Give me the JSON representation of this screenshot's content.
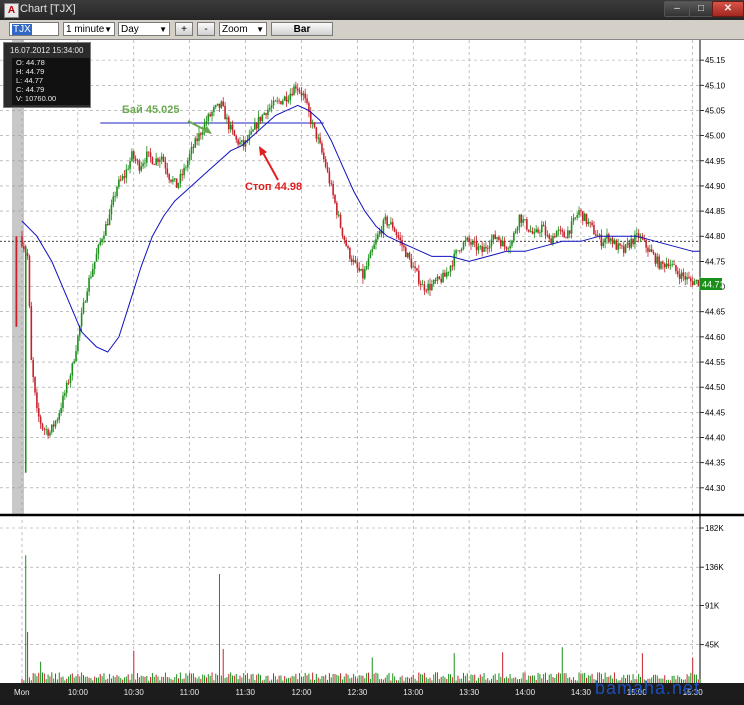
{
  "window": {
    "title": "Chart [TJX]",
    "icon": "app-logo-icon",
    "buttons": {
      "minimize": "–",
      "maximize": "□",
      "close": "✕"
    }
  },
  "toolbar": {
    "symbol": "TJX",
    "interval": "1 minute",
    "range": "Day",
    "zoom_in": "+",
    "zoom_out": "-",
    "zoom": "Zoom",
    "chart_type": "Bar"
  },
  "ohlc_panel": {
    "datetime": "16.07.2012 15:34:00",
    "open": "O: 44.78",
    "high": "H: 44.79",
    "low": "L: 44.77",
    "close": "C: 44.79",
    "volume": "V: 10760.00"
  },
  "annotations": {
    "buy": "Бай 45.025",
    "stop": "Стоп 44.98"
  },
  "colors": {
    "up": "#1a8f1a",
    "down": "#c8202a",
    "ma": "#1010c0",
    "buy_label": "#6aa84f",
    "stop_label": "#e02020",
    "last_price_tag": "#1a8f1a"
  },
  "watermark": "bamaha.net",
  "chart_data": [
    {
      "type": "candlestick",
      "title": "",
      "x_tick_labels": [
        "Mon",
        "10:00",
        "10:30",
        "11:00",
        "11:30",
        "12:00",
        "12:30",
        "13:00",
        "13:30",
        "14:00",
        "14:30",
        "15:00",
        "15:30"
      ],
      "x_tick_minutes": [
        0,
        30,
        60,
        90,
        120,
        150,
        180,
        210,
        240,
        270,
        300,
        330,
        360
      ],
      "price_ticks": [
        45.15,
        45.1,
        45.05,
        45.0,
        44.95,
        44.9,
        44.85,
        44.8,
        44.75,
        44.7,
        44.65,
        44.6,
        44.55,
        44.5,
        44.45,
        44.4,
        44.35,
        44.3
      ],
      "price_tick_labels": [
        "45.15",
        "45.10",
        "45.05",
        "45.00",
        "44.95",
        "44.90",
        "44.85",
        "44.80",
        "44.75",
        "44.70",
        "44.65",
        "44.60",
        "44.55",
        "44.50",
        "44.45",
        "44.40",
        "44.35",
        "44.30"
      ],
      "ylim": [
        44.25,
        45.19
      ],
      "last_price": "44.71",
      "reference_level": 44.79,
      "buy_level": 45.025,
      "stop_level": 44.98,
      "price_path": [
        [
          0,
          44.8
        ],
        [
          4,
          44.76
        ],
        [
          6,
          44.55
        ],
        [
          9,
          44.45
        ],
        [
          12,
          44.42
        ],
        [
          16,
          44.41
        ],
        [
          20,
          44.44
        ],
        [
          25,
          44.5
        ],
        [
          28,
          44.54
        ],
        [
          32,
          44.62
        ],
        [
          36,
          44.7
        ],
        [
          40,
          44.75
        ],
        [
          44,
          44.8
        ],
        [
          48,
          44.84
        ],
        [
          52,
          44.9
        ],
        [
          56,
          44.92
        ],
        [
          60,
          44.96
        ],
        [
          64,
          44.94
        ],
        [
          68,
          44.96
        ],
        [
          72,
          44.95
        ],
        [
          76,
          44.96
        ],
        [
          80,
          44.92
        ],
        [
          84,
          44.9
        ],
        [
          88,
          44.93
        ],
        [
          92,
          44.97
        ],
        [
          96,
          45.0
        ],
        [
          100,
          45.03
        ],
        [
          104,
          45.05
        ],
        [
          108,
          45.06
        ],
        [
          112,
          45.02
        ],
        [
          116,
          44.99
        ],
        [
          120,
          44.98
        ],
        [
          124,
          45.0
        ],
        [
          128,
          45.03
        ],
        [
          132,
          45.05
        ],
        [
          136,
          45.06
        ],
        [
          140,
          45.07
        ],
        [
          144,
          45.08
        ],
        [
          148,
          45.1
        ],
        [
          152,
          45.08
        ],
        [
          156,
          45.03
        ],
        [
          160,
          44.99
        ],
        [
          164,
          44.94
        ],
        [
          168,
          44.88
        ],
        [
          172,
          44.82
        ],
        [
          176,
          44.77
        ],
        [
          180,
          44.74
        ],
        [
          184,
          44.72
        ],
        [
          188,
          44.76
        ],
        [
          192,
          44.8
        ],
        [
          196,
          44.83
        ],
        [
          200,
          44.82
        ],
        [
          204,
          44.79
        ],
        [
          208,
          44.76
        ],
        [
          212,
          44.73
        ],
        [
          216,
          44.7
        ],
        [
          220,
          44.7
        ],
        [
          224,
          44.71
        ],
        [
          228,
          44.72
        ],
        [
          232,
          44.75
        ],
        [
          236,
          44.78
        ],
        [
          240,
          44.79
        ],
        [
          244,
          44.78
        ],
        [
          248,
          44.77
        ],
        [
          252,
          44.79
        ],
        [
          256,
          44.8
        ],
        [
          260,
          44.78
        ],
        [
          264,
          44.79
        ],
        [
          268,
          44.84
        ],
        [
          272,
          44.82
        ],
        [
          276,
          44.8
        ],
        [
          280,
          44.82
        ],
        [
          284,
          44.79
        ],
        [
          288,
          44.81
        ],
        [
          292,
          44.8
        ],
        [
          296,
          44.82
        ],
        [
          300,
          44.85
        ],
        [
          304,
          44.83
        ],
        [
          308,
          44.81
        ],
        [
          312,
          44.79
        ],
        [
          316,
          44.8
        ],
        [
          320,
          44.78
        ],
        [
          324,
          44.77
        ],
        [
          328,
          44.79
        ],
        [
          332,
          44.8
        ],
        [
          336,
          44.78
        ],
        [
          340,
          44.76
        ],
        [
          344,
          44.74
        ],
        [
          348,
          44.75
        ],
        [
          352,
          44.73
        ],
        [
          356,
          44.72
        ],
        [
          360,
          44.71
        ],
        [
          364,
          44.71
        ]
      ],
      "moving_average": [
        [
          0,
          44.83
        ],
        [
          8,
          44.8
        ],
        [
          16,
          44.75
        ],
        [
          24,
          44.68
        ],
        [
          32,
          44.61
        ],
        [
          40,
          44.58
        ],
        [
          46,
          44.57
        ],
        [
          52,
          44.6
        ],
        [
          58,
          44.67
        ],
        [
          64,
          44.74
        ],
        [
          70,
          44.8
        ],
        [
          76,
          44.84
        ],
        [
          82,
          44.87
        ],
        [
          88,
          44.89
        ],
        [
          94,
          44.91
        ],
        [
          100,
          44.93
        ],
        [
          106,
          44.95
        ],
        [
          112,
          44.97
        ],
        [
          118,
          44.98
        ],
        [
          124,
          45.0
        ],
        [
          130,
          45.02
        ],
        [
          136,
          45.04
        ],
        [
          142,
          45.05
        ],
        [
          148,
          45.06
        ],
        [
          154,
          45.05
        ],
        [
          160,
          45.03
        ],
        [
          166,
          44.99
        ],
        [
          172,
          44.94
        ],
        [
          178,
          44.89
        ],
        [
          184,
          44.85
        ],
        [
          190,
          44.82
        ],
        [
          196,
          44.8
        ],
        [
          202,
          44.79
        ],
        [
          208,
          44.78
        ],
        [
          214,
          44.77
        ],
        [
          220,
          44.76
        ],
        [
          230,
          44.76
        ],
        [
          240,
          44.75
        ],
        [
          250,
          44.76
        ],
        [
          260,
          44.77
        ],
        [
          270,
          44.77
        ],
        [
          280,
          44.78
        ],
        [
          290,
          44.79
        ],
        [
          300,
          44.79
        ],
        [
          310,
          44.8
        ],
        [
          320,
          44.8
        ],
        [
          330,
          44.8
        ],
        [
          340,
          44.79
        ],
        [
          350,
          44.78
        ],
        [
          360,
          44.77
        ],
        [
          364,
          44.77
        ]
      ]
    },
    {
      "type": "bar",
      "title": "",
      "y_tick_values": [
        182000,
        136000,
        91000,
        45000
      ],
      "y_tick_labels": [
        "182K",
        "136K",
        "91K",
        "45K"
      ],
      "ylim": [
        0,
        182000
      ],
      "spikes": [
        [
          2,
          150000
        ],
        [
          3,
          60000
        ],
        [
          10,
          25000
        ],
        [
          60,
          38000
        ],
        [
          106,
          128000
        ],
        [
          108,
          40000
        ],
        [
          188,
          30000
        ],
        [
          232,
          35000
        ],
        [
          258,
          36000
        ],
        [
          290,
          42000
        ],
        [
          333,
          35000
        ],
        [
          360,
          30000
        ]
      ],
      "baseline_volume": 9000
    }
  ]
}
